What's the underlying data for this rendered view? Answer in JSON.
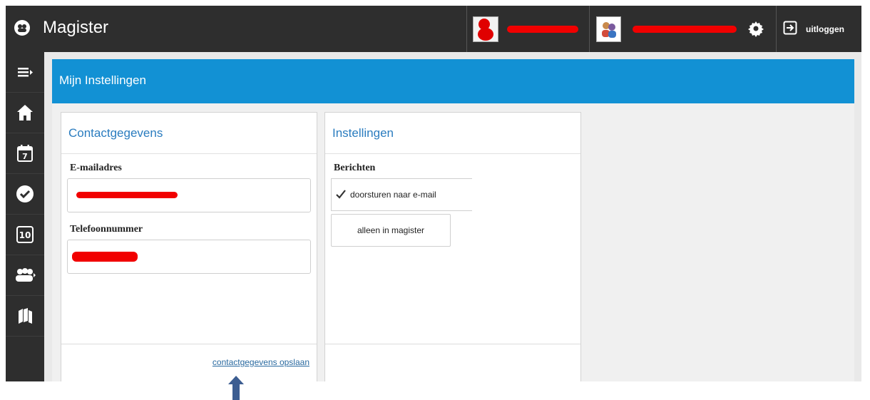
{
  "app": {
    "title": "Magister"
  },
  "topbar": {
    "user1_name": "",
    "user2_name": "",
    "logout_label": "uitloggen"
  },
  "sidebar": {
    "items": [
      {
        "icon": "menu-toggle-icon"
      },
      {
        "icon": "home-icon"
      },
      {
        "icon": "calendar-icon",
        "text": "7"
      },
      {
        "icon": "check-circle-icon"
      },
      {
        "icon": "grades-icon",
        "text": "10"
      },
      {
        "icon": "people-icon"
      },
      {
        "icon": "books-icon"
      }
    ]
  },
  "page": {
    "title": "Mijn Instellingen"
  },
  "contact": {
    "title": "Contactgegevens",
    "email_label": "E-mailadres",
    "email_value": "",
    "phone_label": "Telefoonnummer",
    "phone_value": "",
    "save_link": "contactgegevens opslaan"
  },
  "settings": {
    "title": "Instellingen",
    "messages_label": "Berichten",
    "options": [
      {
        "label": "doorsturen naar e-mail",
        "selected": true
      },
      {
        "label": "alleen in magister",
        "selected": false
      }
    ]
  },
  "colors": {
    "accent": "#1291d4",
    "topbar": "#2e2e2e",
    "annotation_arrow": "#3c5d91"
  }
}
